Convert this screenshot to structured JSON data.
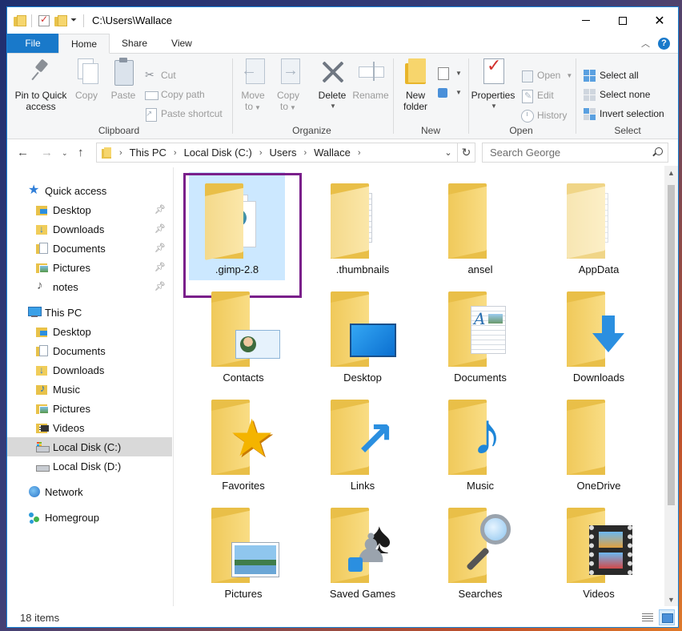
{
  "window": {
    "title": "C:\\Users\\Wallace"
  },
  "ribbon_tabs": [
    "File",
    "Home",
    "Share",
    "View"
  ],
  "ribbon": {
    "clipboard": {
      "label": "Clipboard",
      "pin_label_1": "Pin to Quick",
      "pin_label_2": "access",
      "copy": "Copy",
      "paste": "Paste",
      "cut": "Cut",
      "copy_path": "Copy path",
      "paste_shortcut": "Paste shortcut"
    },
    "organize": {
      "label": "Organize",
      "move_1": "Move",
      "move_2": "to",
      "copy_1": "Copy",
      "copy_2": "to",
      "delete": "Delete",
      "rename": "Rename"
    },
    "new": {
      "label": "New",
      "new_folder_1": "New",
      "new_folder_2": "folder"
    },
    "open": {
      "label": "Open",
      "properties": "Properties",
      "open": "Open",
      "edit": "Edit",
      "history": "History"
    },
    "select": {
      "label": "Select",
      "select_all": "Select all",
      "select_none": "Select none",
      "invert_selection": "Invert selection"
    }
  },
  "address": {
    "crumbs": [
      "This PC",
      "Local Disk (C:)",
      "Users",
      "Wallace"
    ]
  },
  "search": {
    "placeholder": "Search George"
  },
  "nav": {
    "quick_access": "Quick access",
    "quick_items": [
      "Desktop",
      "Downloads",
      "Documents",
      "Pictures",
      "notes"
    ],
    "this_pc": "This PC",
    "pc_items": [
      "Desktop",
      "Documents",
      "Downloads",
      "Music",
      "Pictures",
      "Videos",
      "Local Disk (C:)",
      "Local Disk (D:)"
    ],
    "network": "Network",
    "homegroup": "Homegroup"
  },
  "files": [
    ".gimp-2.8",
    ".thumbnails",
    "ansel",
    "AppData",
    "Contacts",
    "Desktop",
    "Documents",
    "Downloads",
    "Favorites",
    "Links",
    "Music",
    "OneDrive",
    "Pictures",
    "Saved Games",
    "Searches",
    "Videos"
  ],
  "status": {
    "item_count": "18 items"
  },
  "colors": {
    "accent": "#1979ca",
    "selection_frame": "#7a1f8a",
    "selected_tile": "#cce8ff"
  }
}
